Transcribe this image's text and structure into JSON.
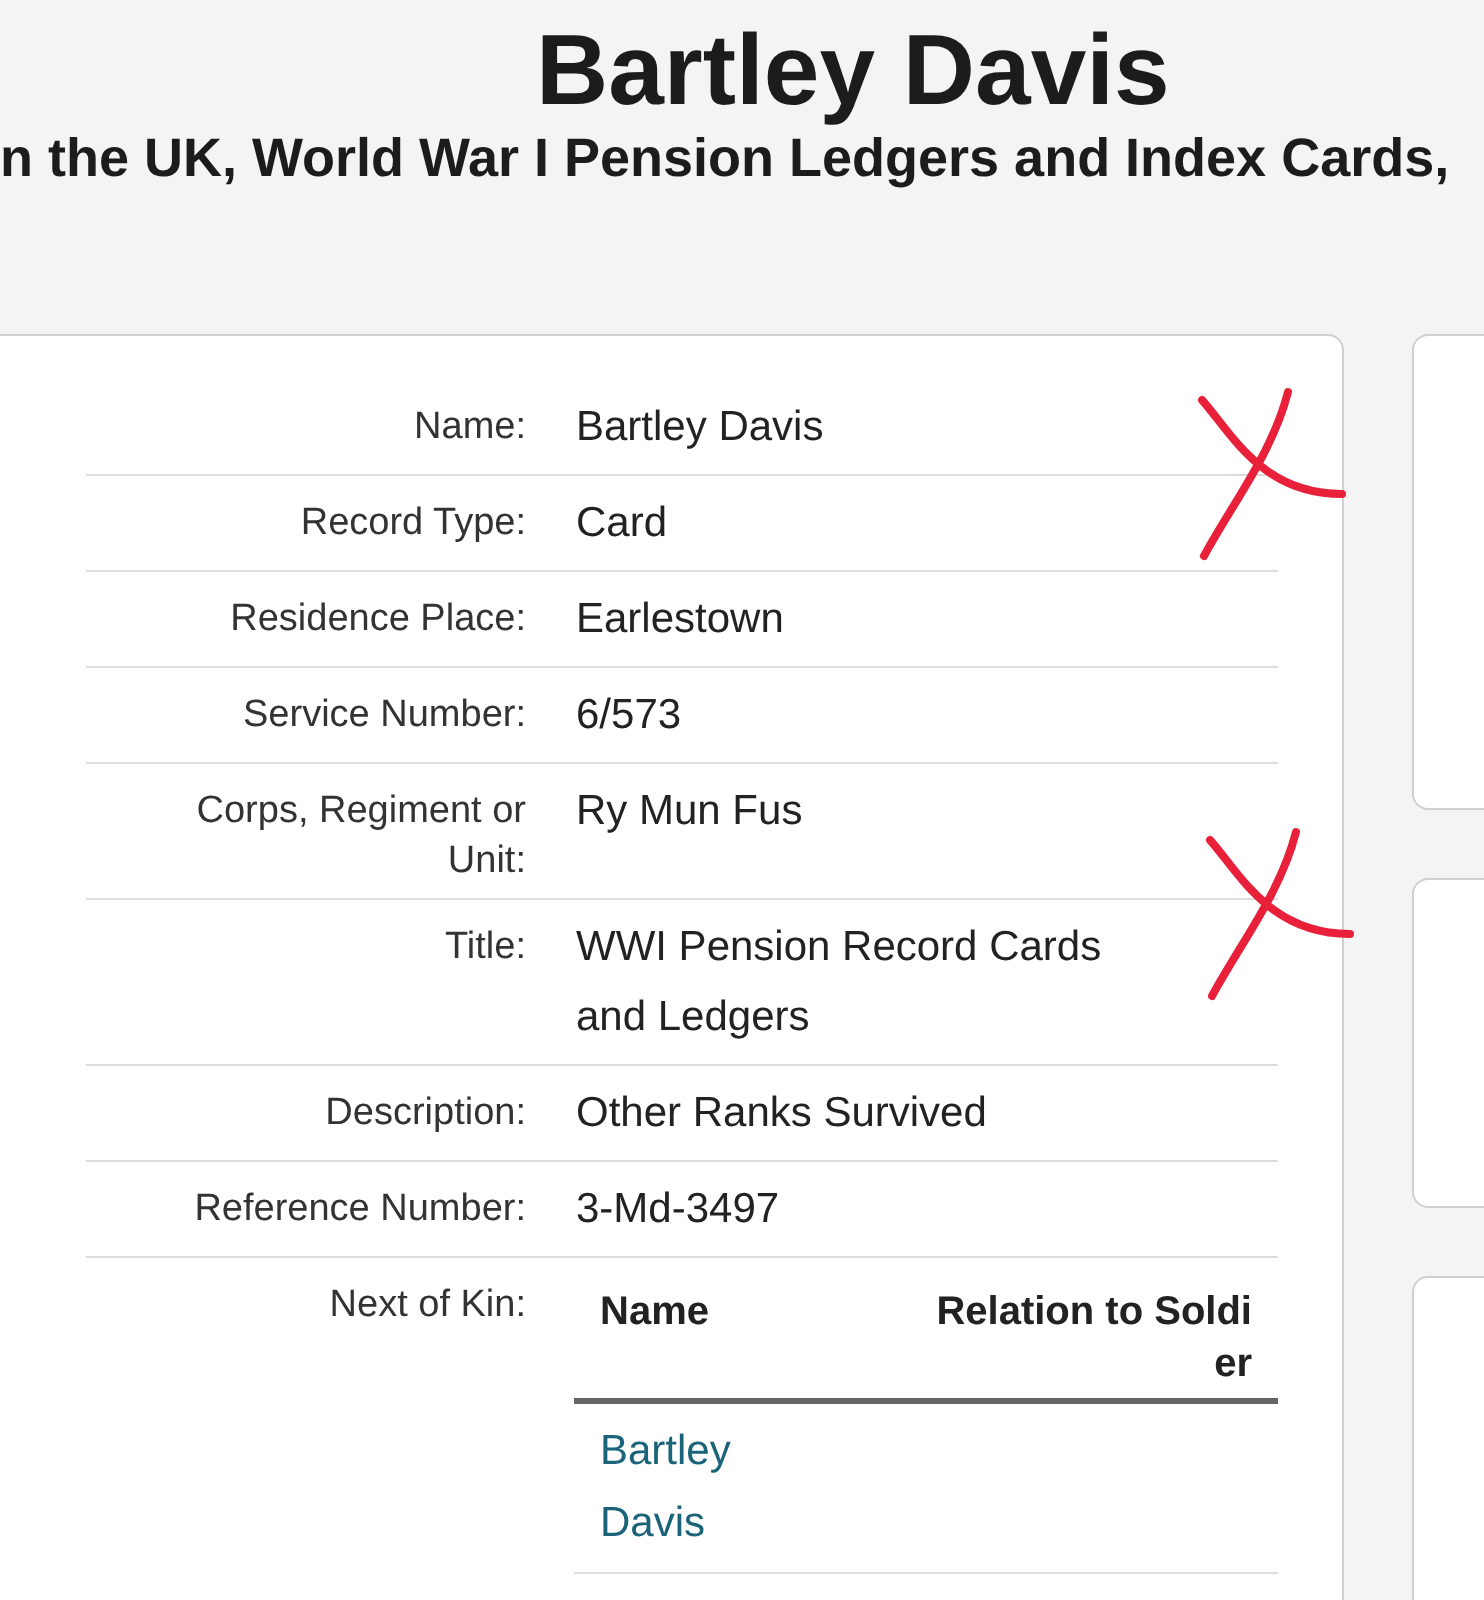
{
  "header": {
    "title": "Bartley Davis",
    "subtitle": "n the UK, World War I Pension Ledgers and Index Cards,"
  },
  "fields": [
    {
      "label": "Name:",
      "value": "Bartley Davis"
    },
    {
      "label": "Record Type:",
      "value": "Card"
    },
    {
      "label": "Residence Place:",
      "value": "Earlestown"
    },
    {
      "label": "Service Number:",
      "value": "6/573"
    },
    {
      "label": "Corps, Regiment or Unit:",
      "value": "Ry Mun Fus"
    },
    {
      "label": "Title:",
      "value": "WWI Pension Record Cards and Ledgers"
    },
    {
      "label": "Description:",
      "value": "Other Ranks Survived"
    },
    {
      "label": "Reference Number:",
      "value": "3-Md-3497"
    }
  ],
  "next_of_kin": {
    "label": "Next of Kin:",
    "columns": [
      "Name",
      "Relation to Soldier"
    ],
    "rows": [
      {
        "name": "Bartley Davis"
      }
    ]
  },
  "annotations": [
    {
      "kind": "cross"
    },
    {
      "kind": "cross"
    }
  ]
}
